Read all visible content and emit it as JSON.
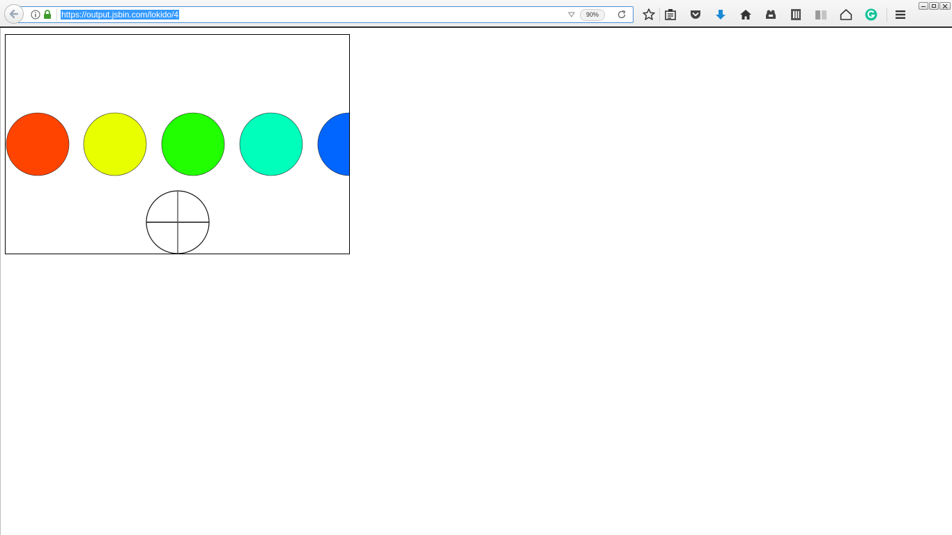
{
  "browser": {
    "url": "https://output.jsbin.com/lokido/4",
    "zoom": "90%",
    "icons": [
      "back-icon",
      "info-icon",
      "lock-icon",
      "dropmarker-icon",
      "reload-icon",
      "bookmark-star-icon",
      "reading-list-icon",
      "pocket-icon",
      "download-icon",
      "home-icon",
      "extension-icon",
      "library-icon",
      "reader-icon",
      "home-outline-icon",
      "grammarly-icon",
      "menu-icon"
    ],
    "window_controls": [
      "minimize",
      "restore",
      "close"
    ]
  },
  "scene": {
    "circles": [
      {
        "name": "red-orange-circle",
        "color": "#ff4400"
      },
      {
        "name": "yellow-circle",
        "color": "#e8ff00"
      },
      {
        "name": "green-circle",
        "color": "#22ff00"
      },
      {
        "name": "aqua-circle",
        "color": "#00ffbb"
      },
      {
        "name": "blue-circle",
        "color": "#0066ff"
      }
    ],
    "crosshair_target_color": "#000000"
  }
}
